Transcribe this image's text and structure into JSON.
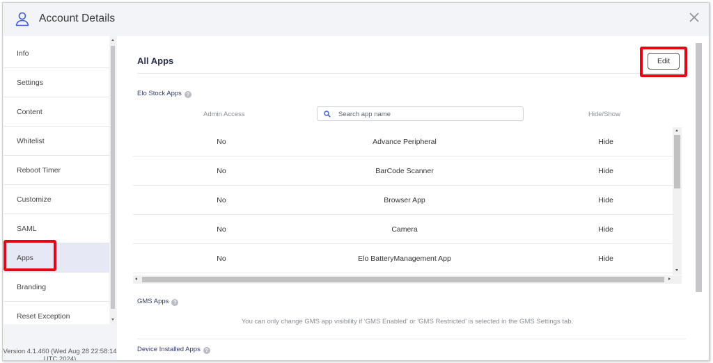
{
  "header": {
    "title": "Account Details",
    "user_icon": "user-outline-icon",
    "close_icon": "close-x-icon"
  },
  "sidebar": {
    "items": [
      {
        "label": "Info"
      },
      {
        "label": "Settings"
      },
      {
        "label": "Content"
      },
      {
        "label": "Whitelist"
      },
      {
        "label": "Reboot Timer"
      },
      {
        "label": "Customize"
      },
      {
        "label": "SAML"
      },
      {
        "label": "Apps",
        "active": true
      },
      {
        "label": "Branding"
      },
      {
        "label": "Reset Exception"
      }
    ],
    "version_line1": "Version 4.1.460 (Wed Aug 28 22:58:14",
    "version_line2": "UTC 2024)"
  },
  "main": {
    "title": "All Apps",
    "edit_label": "Edit",
    "stock_section": {
      "label": "Elo Stock Apps",
      "col_admin": "Admin Access",
      "col_hide": "Hide/Show",
      "search_placeholder": "Search app name",
      "search_value": "",
      "rows": [
        {
          "admin": "No",
          "name": "Advance Peripheral",
          "visibility": "Hide"
        },
        {
          "admin": "No",
          "name": "BarCode Scanner",
          "visibility": "Hide"
        },
        {
          "admin": "No",
          "name": "Browser App",
          "visibility": "Hide"
        },
        {
          "admin": "No",
          "name": "Camera",
          "visibility": "Hide"
        },
        {
          "admin": "No",
          "name": "Elo BatteryManagement App",
          "visibility": "Hide"
        }
      ]
    },
    "gms_section": {
      "label": "GMS Apps",
      "note": "You can only change GMS app visibility if 'GMS Enabled' or 'GMS Restricted' is selected in the GMS Settings tab."
    },
    "device_section": {
      "label": "Device Installed Apps"
    }
  },
  "colors": {
    "accent_blue": "#3b5bdb",
    "highlight_red": "#e30613",
    "active_item_bg": "#e6e9f5",
    "header_bg": "#f3f4f8"
  }
}
